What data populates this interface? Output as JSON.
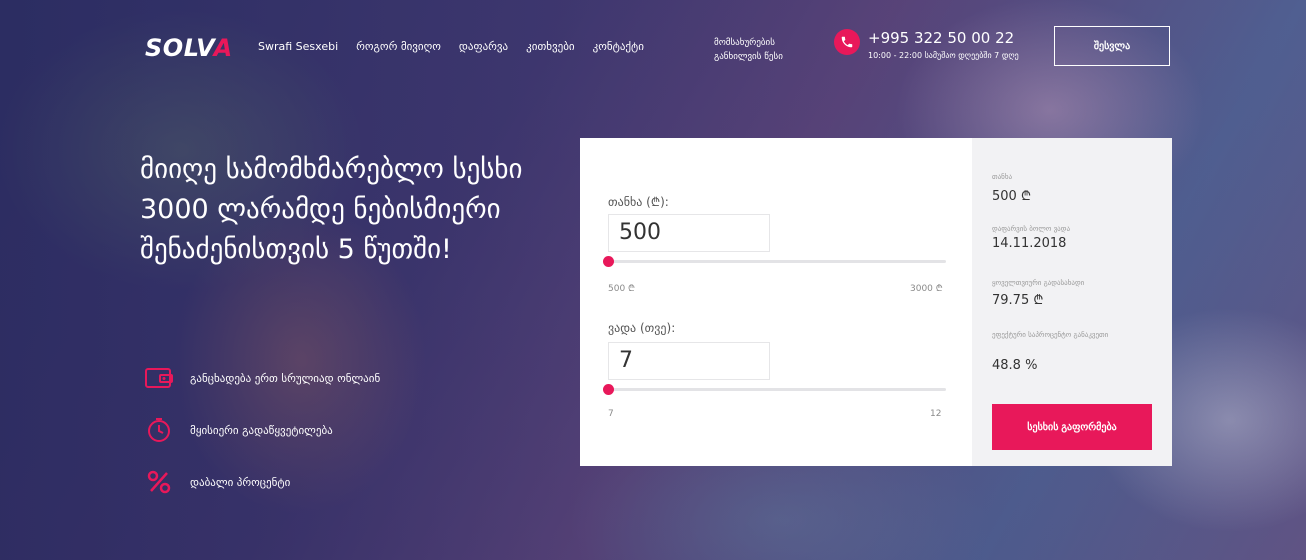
{
  "header": {
    "logo_main": "SOLV",
    "logo_accent": "A",
    "nav": [
      "Swrafi Sesxebi",
      "როგორ მივიღო",
      "დაფარვა",
      "კითხვები",
      "კონტაქტი"
    ],
    "nav_two_line": [
      "მომსახურების",
      "განხილვის წესი"
    ],
    "phone": "+995 322 50 00 22",
    "hours": "10:00 - 22:00 სამუშაო დღეებში 7 დღე",
    "login_label": "შესვლა"
  },
  "hero": {
    "headline": "მიიღე სამომხმარებლო სესხი 3000 ლარამდე ნებისმიერი შენაძენისთვის 5 წუთში!",
    "features": [
      {
        "icon": "wallet-icon",
        "text": "განცხადება ერთ სრულიად ონლაინ"
      },
      {
        "icon": "clock-icon",
        "text": "მყისიერი გადაწყვეტილება"
      },
      {
        "icon": "percent-icon",
        "text": "დაბალი პროცენტი"
      }
    ]
  },
  "calculator": {
    "amount_label": "თანხა (₾):",
    "amount_value": "500",
    "amount_min": "500 ₾",
    "amount_max": "3000 ₾",
    "amount_fill": 0.0,
    "term_label": "ვადა (თვე):",
    "term_value": "7",
    "term_min": "7",
    "term_max": "12",
    "term_fill": 0.0
  },
  "summary": {
    "items": [
      {
        "label": "თანხა",
        "value": "500 ₾"
      },
      {
        "label": "დაფარვის ბოლო ვადა",
        "value": "14.11.2018"
      },
      {
        "label": "ყოველთვიური გადასახადი",
        "value": "79.75 ₾"
      },
      {
        "label": "ეფექტური საპროცენტო განაკვეთი",
        "value": "48.8 %"
      }
    ],
    "button_label": "სესხის გაფორმება"
  },
  "colors": {
    "accent": "#e8185a"
  }
}
